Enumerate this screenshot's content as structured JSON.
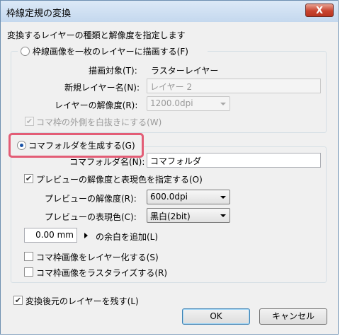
{
  "dialog": {
    "title": "枠線定規の変換",
    "close_label": "X",
    "instruction": "変換するレイヤーの種類と解像度を指定します"
  },
  "draw_layer": {
    "label": "枠線画像を一枚のレイヤーに描画する(F)",
    "target_label": "描画対象(T):",
    "target_value": "ラスターレイヤー",
    "name_label": "新規レイヤー名(N):",
    "name_value": "レイヤー 2",
    "resolution_label": "レイヤーの解像度(R):",
    "resolution_value": "1200.0dpi",
    "outside_label": "コマ枠の外側を白抜きにする(W)"
  },
  "folder": {
    "label": "コマフォルダを生成する(G)",
    "name_label": "コマフォルダ名(N):",
    "name_value": "コマフォルダ",
    "preview_check_label": "プレビューの解像度と表現色を指定する(O)",
    "preview_res_label": "プレビューの解像度(R):",
    "preview_res_value": "600.0dpi",
    "preview_color_label": "プレビューの表現色(C):",
    "preview_color_value": "黒白(2bit)",
    "margin_value": "0.00 mm",
    "margin_label": "の余白を追加(L)",
    "to_layer_label": "コマ枠画像をレイヤー化する(S)",
    "rasterize_label": "コマ枠画像をラスタライズする(R)"
  },
  "keep_source_label": "変換後元のレイヤーを残す(L)",
  "ok_label": "OK",
  "cancel_label": "キャンセル"
}
